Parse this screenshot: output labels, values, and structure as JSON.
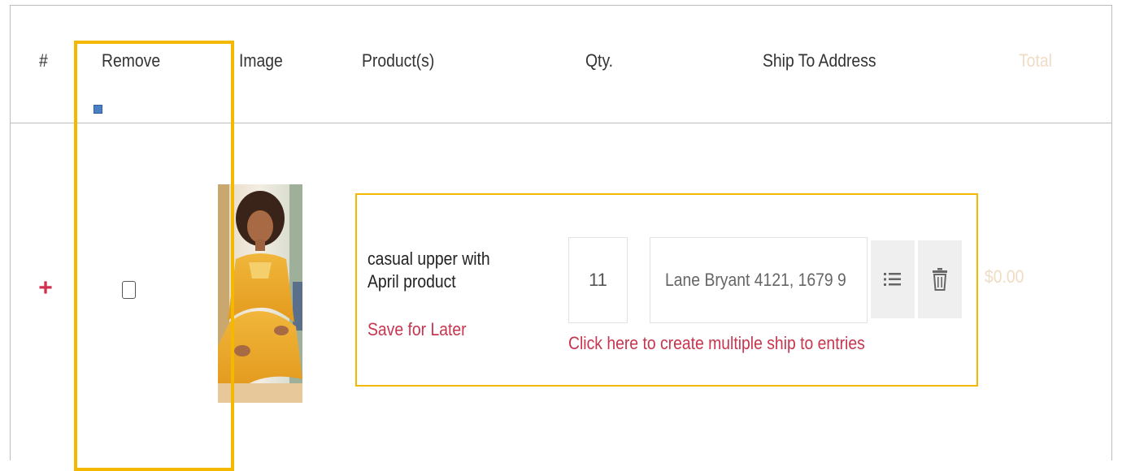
{
  "table": {
    "headers": {
      "index": "#",
      "remove": "Remove",
      "image": "Image",
      "products": "Product(s)",
      "qty": "Qty.",
      "ship_to": "Ship To Address",
      "total": "Total"
    }
  },
  "row": {
    "expand_icon": "+",
    "product_name": "casual upper with April product",
    "save_for_later": "Save for Later",
    "quantity": "11",
    "ship_address": "Lane Bryant 4121, 1679 9",
    "ship_link": "Click here to create multiple ship to entries",
    "total": "$0.00",
    "image_alt": "product photo",
    "icons": {
      "list": "list-icon",
      "trash": "trash-icon"
    }
  },
  "colors": {
    "accent_red": "#c8354f",
    "highlight": "#f5b800",
    "total_muted": "#f0dcc4",
    "checkbox_blue": "#4a7fc4"
  }
}
